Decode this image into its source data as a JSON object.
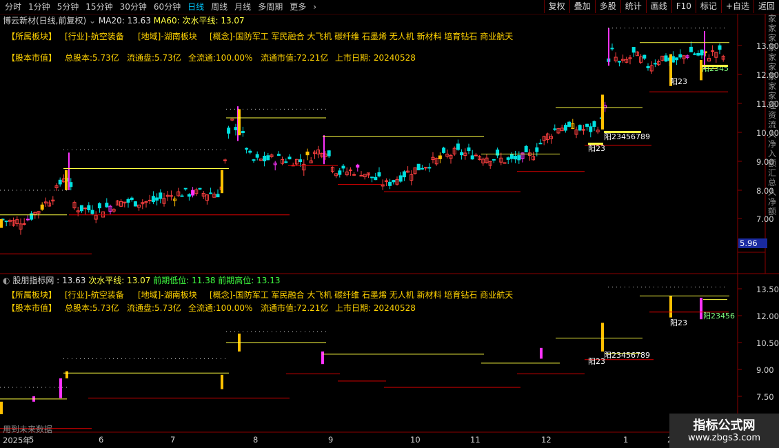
{
  "toolbar": {
    "periods": [
      "分时",
      "1分钟",
      "5分钟",
      "15分钟",
      "30分钟",
      "60分钟",
      "日线",
      "周线",
      "月线",
      "多周期",
      "更多"
    ],
    "active_period": "日线",
    "buttons": [
      "复权",
      "叠加",
      "多股",
      "统计",
      "画线",
      "F10",
      "标记",
      "+自选",
      "返回"
    ]
  },
  "main_panel": {
    "title": "博云新材(日线,前复权)",
    "ma20": "MA20: 13.63",
    "ma60": "MA60: 次水平线: 13.07",
    "sector_label": "【所属板块】",
    "industry": "[行业]-航空装备",
    "region": "[地域]-湖南板块",
    "concepts": "[概念]-国防军工 军民融合 大飞机 碳纤维 石墨烯 无人机 新材料 培育钻石 商业航天",
    "market_label": "【股本市值】",
    "total_shares": "总股本:5.73亿",
    "float_shares": "流通盘:5.73亿",
    "full_float": "全流通:100.00%",
    "float_value": "流通市值:72.21亿",
    "listing_date": "上市日期: 20240528",
    "y_axis": [
      "13.00",
      "12.00",
      "11.00",
      "10.00",
      "9.00",
      "8.00",
      "7.00"
    ],
    "cursor_value": "5.96",
    "annotations": [
      "阳2345",
      "阳23",
      "阳23456789",
      "阳23",
      "阳23"
    ]
  },
  "sub_panel": {
    "title": "股朋指标网",
    "value": ": 13.63",
    "water": "次水平线: 13.07",
    "prev_low": "前期低位: 11.38",
    "prev_high": "前期高位: 13.13",
    "y_axis": [
      "13.50",
      "12.00",
      "10.50",
      "9.00",
      "7.50"
    ],
    "annotations": [
      "阳23456",
      "阳23",
      "阳23456789",
      "阳23"
    ],
    "footer_text": "用到未来数据"
  },
  "x_axis": [
    "2025年",
    "5",
    "6",
    "7",
    "8",
    "9",
    "10",
    "11",
    "12",
    "1",
    "2"
  ],
  "side_strip": [
    "家",
    "家",
    "家",
    "家",
    "家",
    "家",
    "家",
    "家",
    "家",
    "理",
    "资",
    "流",
    "入",
    "净",
    "入",
    "额",
    "汇",
    "总",
    "入",
    "净",
    "额"
  ],
  "watermark": {
    "line1": "指标公式网",
    "line2": "www.zbgs3.com"
  },
  "colors": {
    "up": "#ff4040",
    "down": "#00e0e0",
    "magenta": "#ff33ff",
    "gold": "#ffc000",
    "yellow_line": "#ffff40",
    "red_line": "#e00000"
  }
}
